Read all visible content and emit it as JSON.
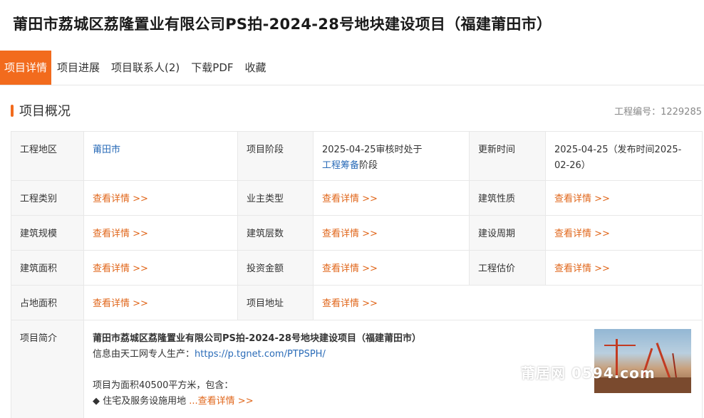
{
  "page": {
    "title": "莆田市荔城区荔隆置业有限公司PS拍-2024-28号地块建设项目（福建莆田市）"
  },
  "tabs": [
    {
      "label": "项目详情",
      "active": true
    },
    {
      "label": "项目进展",
      "active": false
    },
    {
      "label": "项目联系人(2)",
      "active": false
    },
    {
      "label": "下载PDF",
      "active": false
    },
    {
      "label": "收藏",
      "active": false
    }
  ],
  "section": {
    "title": "项目概况",
    "project_no": "工程编号：1229285"
  },
  "info": {
    "region_label": "工程地区",
    "region_value": "莆田市",
    "stage_label": "项目阶段",
    "stage_prefix": "2025-04-25审核时处于",
    "stage_link": "工程筹备",
    "stage_suffix": "阶段",
    "update_label": "更新时间",
    "update_value": "2025-04-25（发布时间2025-02-26）",
    "more_link": "查看详情 >>",
    "type_label": "工程类别",
    "owner_label": "业主类型",
    "nature_label": "建筑性质",
    "scale_label": "建筑规模",
    "floors_label": "建筑层数",
    "period_label": "建设周期",
    "area_label": "建筑面积",
    "investment_label": "投资金额",
    "estimate_label": "工程估价",
    "land_label": "占地面积",
    "address_label": "项目地址",
    "intro_label": "项目简介"
  },
  "intro": {
    "title": "莆田市荔城区荔隆置业有限公司PS拍-2024-28号地块建设项目（福建莆田市）",
    "source_prefix": "信息由天工网专人生产：",
    "source_link": "https://p.tgnet.com/PTPSPH/",
    "body": "项目为面积40500平方米，包含：",
    "bullet": "◆ 住宅及服务设施用地",
    "more": "...查看详情 >>"
  },
  "watermark": "莆居网 0594.com",
  "colors": {
    "accent": "#f26b1d",
    "link_blue": "#2b6cb8",
    "link_orange": "#e0661a"
  }
}
